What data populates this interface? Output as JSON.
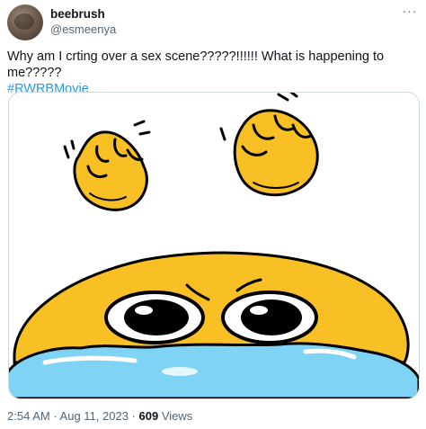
{
  "author": {
    "display_name": "beebrush",
    "handle": "@esmeenya"
  },
  "more_icon": "more-horizontal-icon",
  "tweet": {
    "text": "Why am I crting over a sex scene?????!!!!!! What is happening to me?????",
    "hashtag": "#RWRBMovie"
  },
  "media": {
    "description_icon": "crying-emoji-meme-image"
  },
  "meta": {
    "time": "2:54 AM",
    "separator": " · ",
    "date": "Aug 11, 2023",
    "views_count": "609",
    "views_label": "Views"
  },
  "colors": {
    "link": "#1d9bf0",
    "secondary_text": "#536471",
    "emoji_yellow": "#f8c024",
    "tears": "#7fd3f4"
  }
}
